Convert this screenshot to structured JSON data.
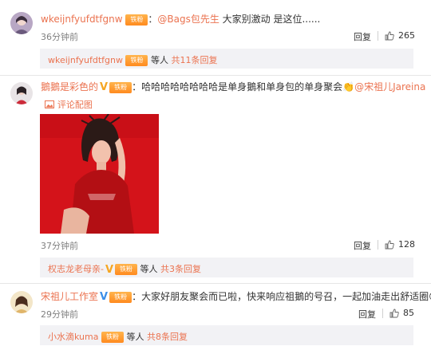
{
  "comments": [
    {
      "user": "wkeijnfyufdtfgnw",
      "badge": "铁粉",
      "colon": "：",
      "mention": "@Bags包先生",
      "text": " 大家别激动 是这位......",
      "time": "36分钟前",
      "reply_label": "回复",
      "likes": "265",
      "sub_user": "wkeijnfyufdtfgnw",
      "sub_badge": "铁粉",
      "sub_others": "等人",
      "sub_count": "共11条回复"
    },
    {
      "user": "鵝鵝是彩色的",
      "badge": "铁粉",
      "colon": "：",
      "text": "哈哈哈哈哈哈哈哈是单身鵝和单身包的单身聚会",
      "emoji": "👏",
      "mention": "@宋祖儿Jareina",
      "image_link": "评论配图",
      "time": "37分钟前",
      "reply_label": "回复",
      "likes": "128",
      "sub_user": "权志龙老母亲-",
      "sub_badge": "铁粉",
      "sub_others": "等人",
      "sub_count": "共3条回复"
    },
    {
      "user": "宋祖儿工作室",
      "badge": "铁粉",
      "colon": "：",
      "text": "大家好朋友聚会而已啦，快来响应祖鵝的号召，一起加油走出舒适圈",
      "emoji": "😎",
      "time": "29分钟前",
      "reply_label": "回复",
      "likes": "85",
      "sub_user": "小水滴kuma",
      "sub_badge": "铁粉",
      "sub_others": "等人",
      "sub_count": "共8条回复"
    }
  ],
  "icons": {
    "image_icon": "picture-icon",
    "thumb_icon": "thumbs-up-icon",
    "vip_icon": "verified-v-icon"
  },
  "colors": {
    "name": "#eb7350",
    "badge": "#ff9a2e",
    "photo_red": "#c8171b"
  }
}
